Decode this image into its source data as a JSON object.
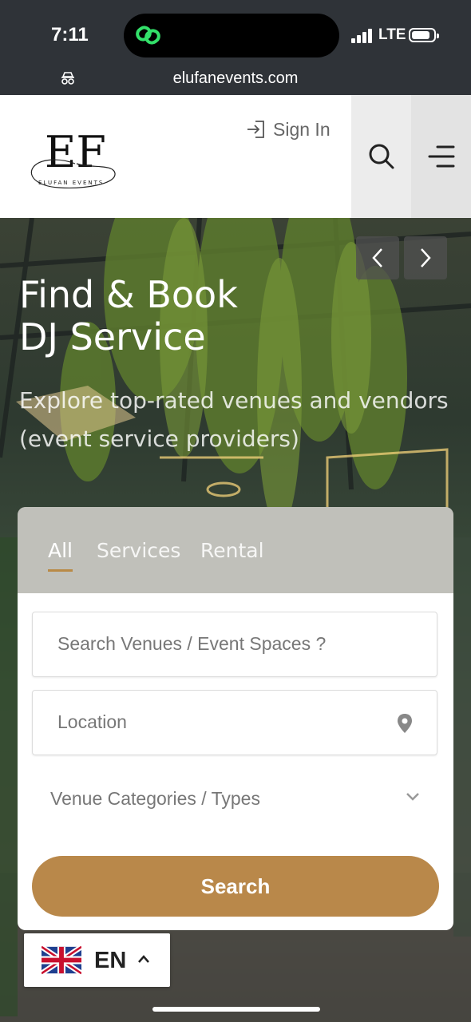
{
  "status_bar": {
    "time": "7:11",
    "network": "LTE"
  },
  "browser": {
    "url": "elufanevents.com"
  },
  "header": {
    "logo_text": "EF",
    "logo_subtext": "ELUFAN EVENTS",
    "signin_label": "Sign In"
  },
  "hero": {
    "title_line1": "Find & Book",
    "title_line2": "DJ Service",
    "subtitle": "Explore top-rated venues and vendors (event service providers)"
  },
  "search_card": {
    "tabs": [
      {
        "label": "All",
        "active": true
      },
      {
        "label": "Services",
        "active": false
      },
      {
        "label": "Rental",
        "active": false
      }
    ],
    "search_placeholder": "Search Venues / Event Spaces ?",
    "location_placeholder": "Location",
    "category_select": "Venue Categories / Types",
    "search_button": "Search"
  },
  "language": {
    "code": "EN"
  },
  "colors": {
    "accent": "#b9884a",
    "status_bg": "#2f3338"
  }
}
